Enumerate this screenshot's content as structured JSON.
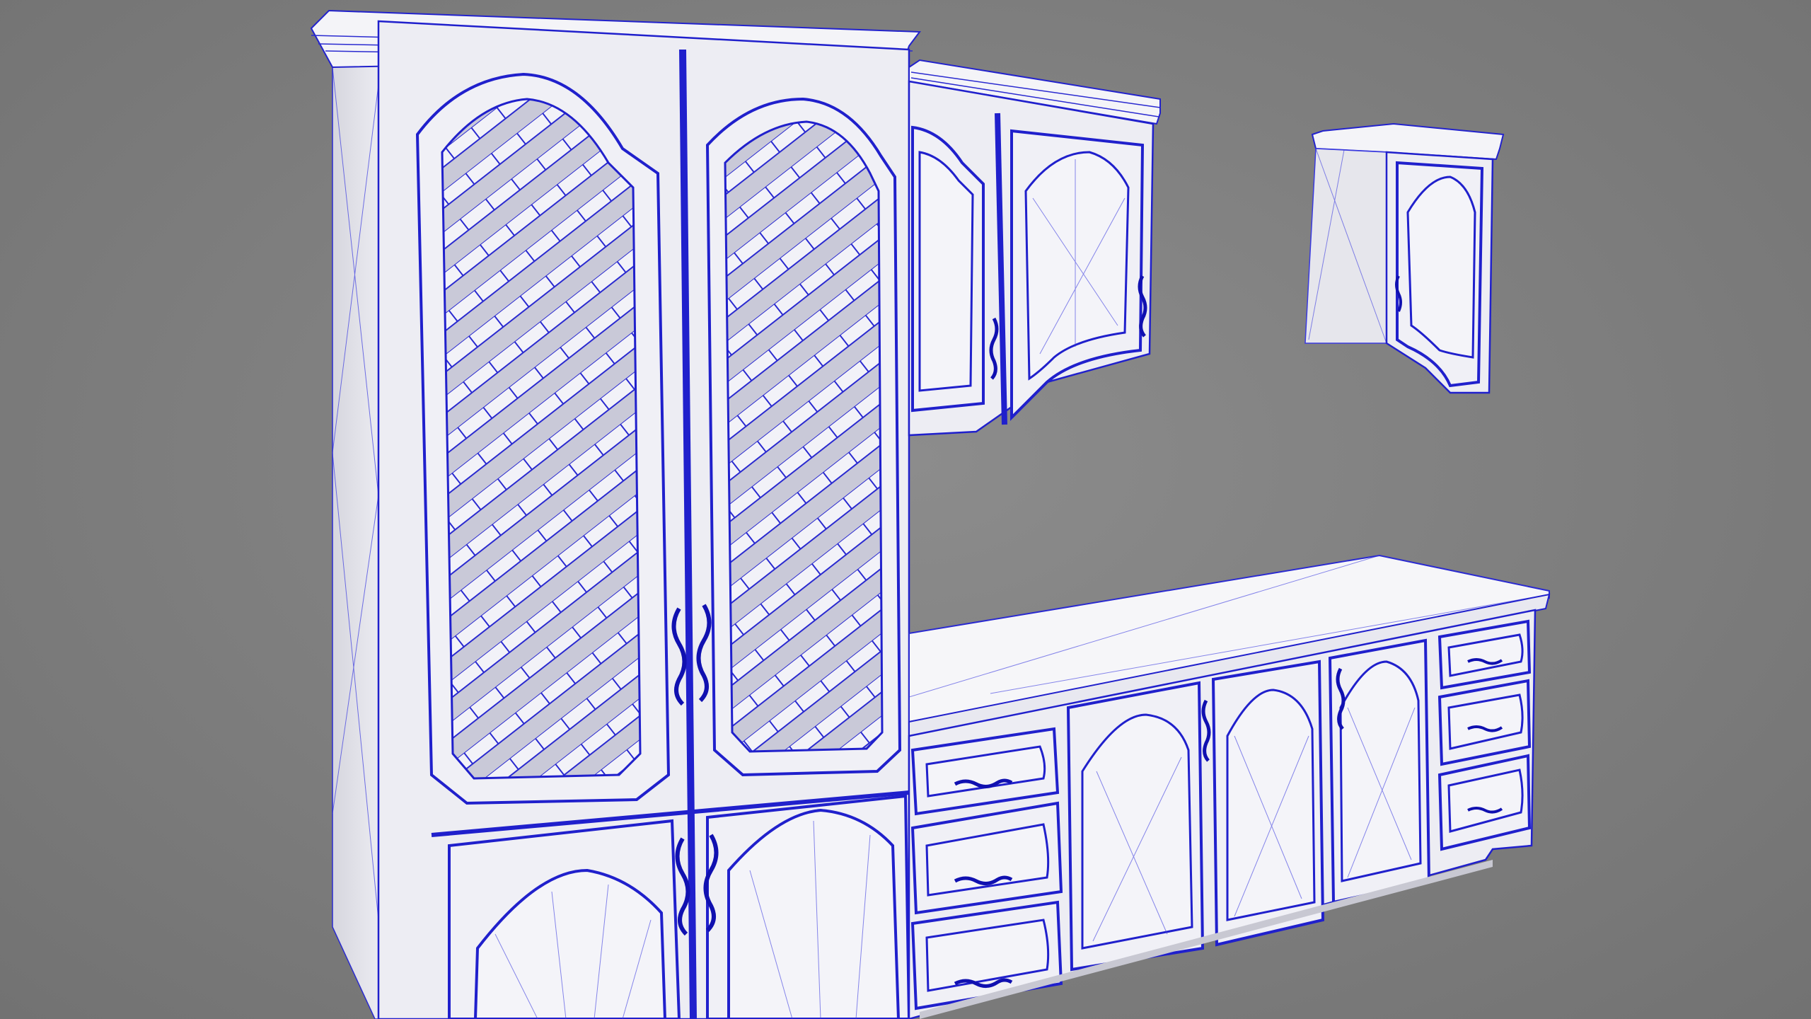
{
  "scene": {
    "background_color": "#808080",
    "model_fill_color": "#eeeef4",
    "model_side_color": "#d8d8e0",
    "wireframe_color": "#1f1fd0",
    "handle_color": "#1010b0",
    "objects": [
      "tall-pantry-cabinet",
      "upper-wall-cabinet",
      "small-corner-wall-cabinet",
      "base-cabinet-counter"
    ]
  }
}
